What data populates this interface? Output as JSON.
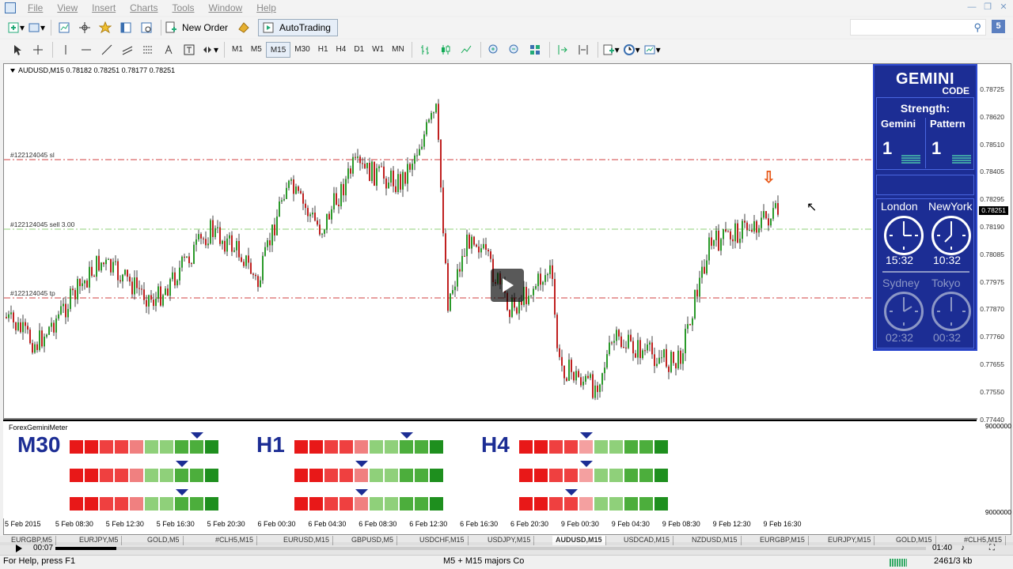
{
  "menu": [
    "File",
    "View",
    "Insert",
    "Charts",
    "Tools",
    "Window",
    "Help"
  ],
  "toolbar": {
    "new_order": "New Order",
    "autotrading": "AutoTrading"
  },
  "timeframes": [
    "M1",
    "M5",
    "M15",
    "M30",
    "H1",
    "H4",
    "D1",
    "W1",
    "MN"
  ],
  "active_timeframe": "M15",
  "chart": {
    "symbol_info": "AUDUSD,M15  0.78182 0.78251 0.78177 0.78251",
    "current_price": "0.78251",
    "price_ticks": [
      "0.78725",
      "0.78620",
      "0.78510",
      "0.78405",
      "0.78295",
      "0.78190",
      "0.78085",
      "0.77975",
      "0.77870",
      "0.77760",
      "0.77655",
      "0.77550",
      "0.77440"
    ],
    "orders": {
      "sl": "#122124045 sl",
      "sell": "#122124045 sell 3.00",
      "tp": "#122124045 tp"
    },
    "time_ticks": [
      "5 Feb 2015",
      "5 Feb 08:30",
      "5 Feb 12:30",
      "5 Feb 16:30",
      "5 Feb 20:30",
      "6 Feb 00:30",
      "6 Feb 04:30",
      "6 Feb 08:30",
      "6 Feb 12:30",
      "6 Feb 16:30",
      "6 Feb 20:30",
      "9 Feb 00:30",
      "9 Feb 04:30",
      "9 Feb 08:30",
      "9 Feb 12:30",
      "9 Feb 16:30"
    ]
  },
  "gemini": {
    "title": "GEMINI",
    "subtitle": "CODE",
    "strength_label": "Strength:",
    "col_gemini": "Gemini",
    "col_pattern": "Pattern",
    "gemini_value": "1",
    "pattern_value": "1",
    "clocks": [
      {
        "city": "London",
        "time": "15:32",
        "active": true
      },
      {
        "city": "NewYork",
        "time": "10:32",
        "active": true
      },
      {
        "city": "Sydney",
        "time": "02:32",
        "active": false
      },
      {
        "city": "Tokyo",
        "time": "00:32",
        "active": false
      }
    ]
  },
  "indicator": {
    "name": "ForexGeminiMeter",
    "scale_top": "9000000",
    "scale_bottom": "9000000",
    "timeframes": [
      "M30",
      "H1",
      "H4"
    ],
    "colors": {
      "dark_red": "#e81818",
      "red": "#ef4040",
      "light_red": "#f08080",
      "pink": "#f4a0a0",
      "light_green": "#8fd07a",
      "green": "#4cae3c",
      "dark_green": "#1e8f1e"
    }
  },
  "symbol_tabs": [
    "EURGBP,M5",
    "EURJPY,M5",
    "GOLD,M5",
    "#CLH5,M15",
    "EURUSD,M15",
    "GBPUSD,M5",
    "USDCHF,M15",
    "USDJPY,M15",
    "AUDUSD,M15",
    "USDCAD,M15",
    "NZDUSD,M15",
    "EURGBP,M15",
    "EURJPY,M15",
    "GOLD,M15",
    "#CLH5,M15"
  ],
  "active_symbol": "AUDUSD,M15",
  "video": {
    "elapsed": "00:07",
    "total": "01:40",
    "progress": 0.07
  },
  "status": {
    "help": "For Help, press F1",
    "profile": "M5 + M15 majors Co",
    "traffic": "2461/3 kb"
  }
}
